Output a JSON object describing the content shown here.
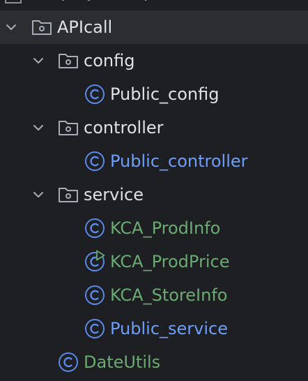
{
  "tree": {
    "top_partial_label": "src/projects/apost",
    "root": {
      "label": "APIcall",
      "expanded": true
    },
    "config": {
      "label": "config",
      "expanded": true
    },
    "public_config": {
      "label": "Public_config"
    },
    "controller": {
      "label": "controller",
      "expanded": true
    },
    "public_controller": {
      "label": "Public_controller"
    },
    "service": {
      "label": "service",
      "expanded": true
    },
    "kca_prodinfo": {
      "label": "KCA_ProdInfo"
    },
    "kca_prodprice": {
      "label": "KCA_ProdPrice"
    },
    "kca_storeinfo": {
      "label": "KCA_StoreInfo"
    },
    "public_service": {
      "label": "Public_service"
    },
    "dateutils": {
      "label": "DateUtils"
    }
  },
  "colors": {
    "background": "#1e1f22",
    "selected_row": "#2b2d30",
    "class_icon": "#5b8ae8",
    "run_badge": "#6aab73",
    "label_default": "#dfe1e5",
    "label_modified_blue": "#6d9ef8",
    "label_new_green": "#6aab73"
  }
}
